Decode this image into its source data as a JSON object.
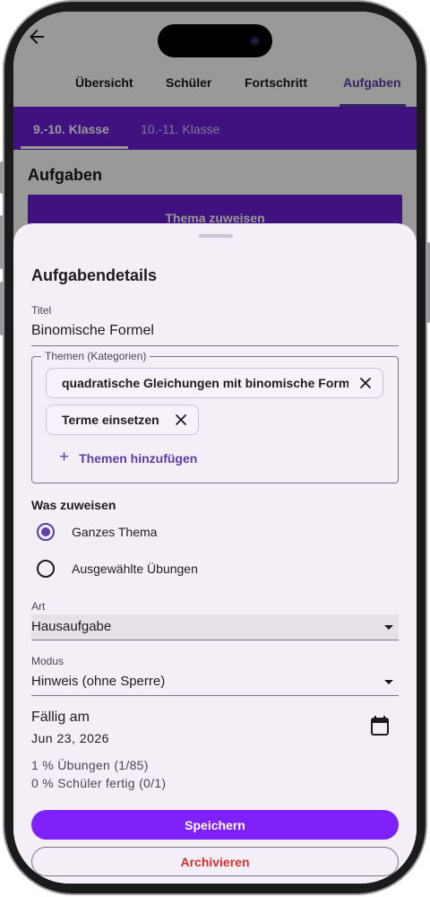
{
  "app": {
    "top_tabs": [
      "Übersicht",
      "Schüler",
      "Fortschritt",
      "Aufgaben"
    ],
    "active_top_tab": "Aufgaben",
    "class_tabs": [
      "9.-10. Klasse",
      "10.-11. Klasse"
    ],
    "active_class_tab": "9.-10. Klasse",
    "heading": "Aufgaben",
    "banner_label": "Thema zuweisen"
  },
  "sheet": {
    "title": "Aufgabendetails",
    "title_field": {
      "label": "Titel",
      "value": "Binomische Formel"
    },
    "themes": {
      "legend": "Themen (Kategorien)",
      "chips": [
        "quadratische Gleichungen mit binomische Formeln",
        "Terme einsetzen"
      ],
      "add_label": "Themen hinzufügen"
    },
    "assign": {
      "label": "Was zuweisen",
      "options": [
        "Ganzes Thema",
        "Ausgewählte Übungen"
      ],
      "selected": "Ganzes Thema"
    },
    "art": {
      "label": "Art",
      "value": "Hausaufgabe"
    },
    "modus": {
      "label": "Modus",
      "value": "Hinweis (ohne Sperre)"
    },
    "due": {
      "title": "Fällig am",
      "date": "Jun 23, 2026"
    },
    "stats": [
      "1 % Übungen (1/85)",
      "0 % Schüler fertig (0/1)"
    ],
    "save_label": "Speichern",
    "archive_label": "Archivieren"
  },
  "colors": {
    "accent": "#5b3ea6",
    "primary_button": "#7e21fa",
    "class_bar": "#6a1fd6",
    "danger": "#d32f2f"
  }
}
